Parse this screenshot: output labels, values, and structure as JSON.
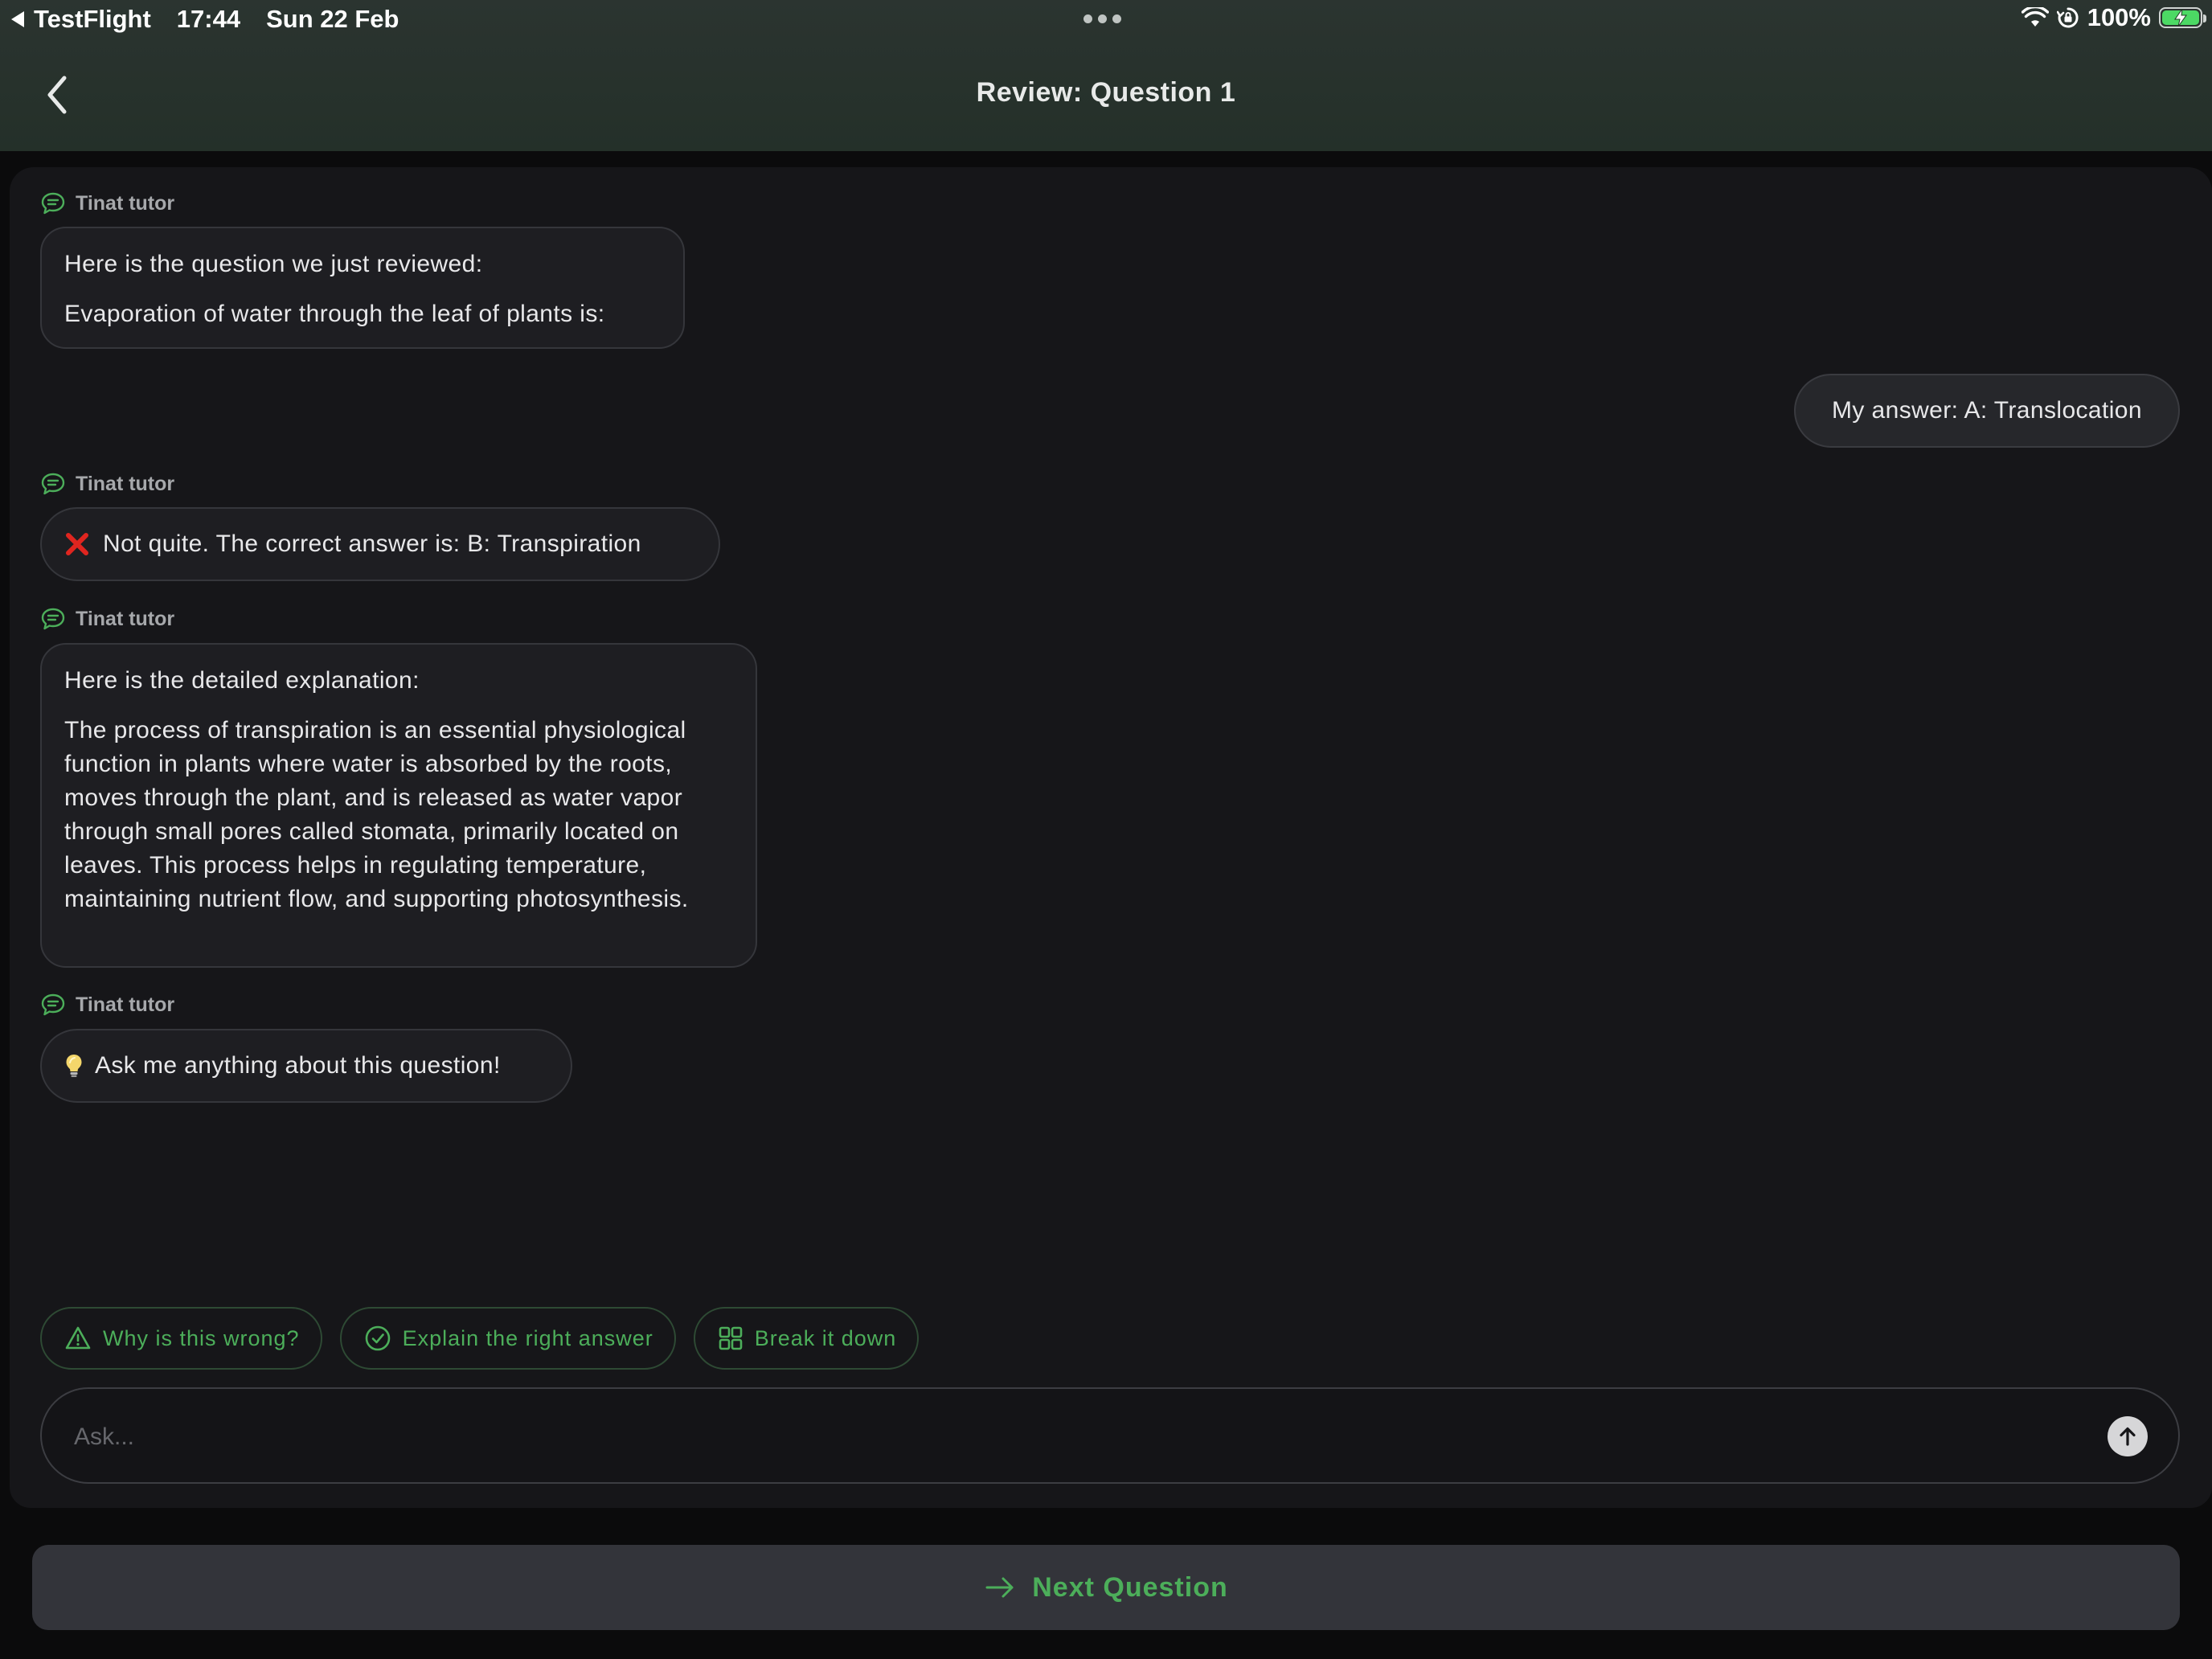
{
  "status_bar": {
    "app": "TestFlight",
    "time": "17:44",
    "date": "Sun 22 Feb",
    "battery": "100%",
    "icons": [
      "back-triangle-icon",
      "wifi-icon",
      "orientation-lock-icon",
      "battery-charging-icon"
    ]
  },
  "nav": {
    "title": "Review: Question 1",
    "back_icon": "chevron-left-icon"
  },
  "colors": {
    "header_bg": "#28322d",
    "panel_bg": "#161619",
    "accent_green": "#4cae5a",
    "error_red": "#e0251f"
  },
  "messages": [
    {
      "sender": "Tinat tutor",
      "lines": [
        "Here is the question we just reviewed:",
        "Evaporation of water through the leaf of plants is:"
      ]
    },
    {
      "sender": "user",
      "text": "My answer: A: Translocation"
    },
    {
      "sender": "Tinat tutor",
      "icon": "red-x-icon",
      "text": "Not quite. The correct answer is: B: Transpiration"
    },
    {
      "sender": "Tinat tutor",
      "lines": [
        "Here is the detailed explanation:",
        "The process of transpiration is an essential physiological function in plants where water is absorbed by the roots, moves through the plant, and is released as water vapor through small pores called stomata, primarily located on leaves. This process helps in regulating temperature, maintaining nutrient flow, and supporting photosynthesis."
      ]
    },
    {
      "sender": "Tinat tutor",
      "icon": "lightbulb-icon",
      "text": "Ask me anything about this question!"
    }
  ],
  "chips": [
    {
      "label": "Why is this wrong?",
      "icon": "warning-triangle-icon"
    },
    {
      "label": "Explain the right answer",
      "icon": "check-circle-icon"
    },
    {
      "label": "Break it down",
      "icon": "grid-icon"
    }
  ],
  "input": {
    "placeholder": "Ask...",
    "value": ""
  },
  "next_button": {
    "label": "Next Question",
    "icon": "arrow-right-icon"
  }
}
